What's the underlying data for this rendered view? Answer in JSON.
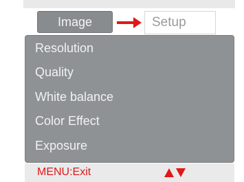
{
  "tabs": {
    "active_label": "Image",
    "inactive_label": "Setup"
  },
  "menu": {
    "items": [
      {
        "label": "Resolution"
      },
      {
        "label": "Quality"
      },
      {
        "label": "White balance"
      },
      {
        "label": "Color Effect"
      },
      {
        "label": "Exposure"
      }
    ]
  },
  "footer": {
    "exit_label": "MENU:Exit"
  },
  "colors": {
    "panel": "#8e9294",
    "active_tab": "#888c8e",
    "accent_red": "#e01818"
  },
  "icons": {
    "tab_arrow": "right-arrow-icon",
    "navigation": "up-down-arrows-icon"
  }
}
